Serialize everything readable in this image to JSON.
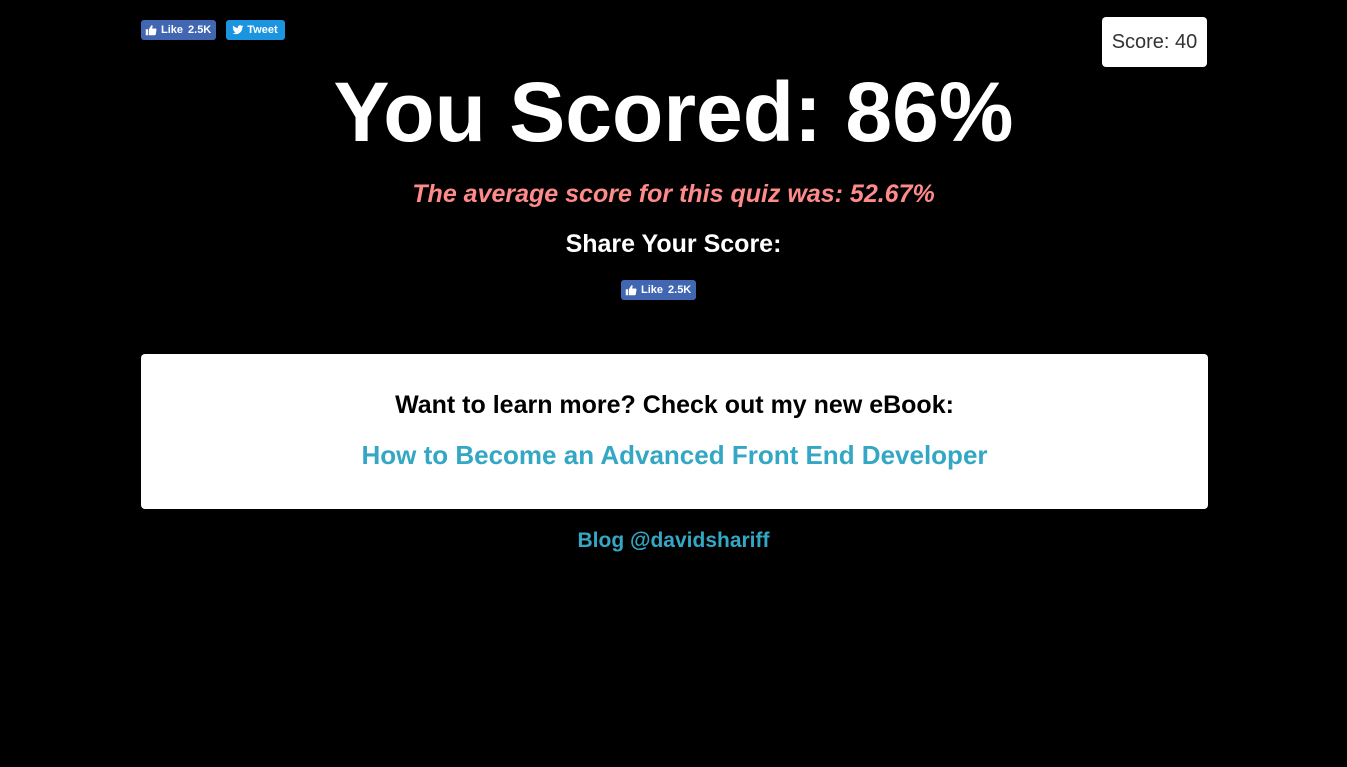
{
  "social_top": {
    "like_label": "Like",
    "like_count": "2.5K",
    "tweet_label": "Tweet"
  },
  "score_box": {
    "text": "Score: 40"
  },
  "result": {
    "headline": "You Scored: 86%",
    "average_text": "The average score for this quiz was: 52.67%",
    "share_heading": "Share Your Score:"
  },
  "share_like": {
    "like_label": "Like",
    "like_count": "2.5K"
  },
  "ebook": {
    "title": "Want to learn more? Check out my new eBook:",
    "link_text": "How to Become an Advanced Front End Developer"
  },
  "footer": {
    "blog_link": "Blog @davidshariff"
  },
  "colors": {
    "background": "#000000",
    "average_text": "#ff8a8a",
    "link": "#33a7c4",
    "facebook": "#4267b2",
    "twitter": "#1b95e0"
  },
  "icons": {
    "like": "thumbs-up-icon",
    "tweet": "twitter-bird-icon"
  }
}
